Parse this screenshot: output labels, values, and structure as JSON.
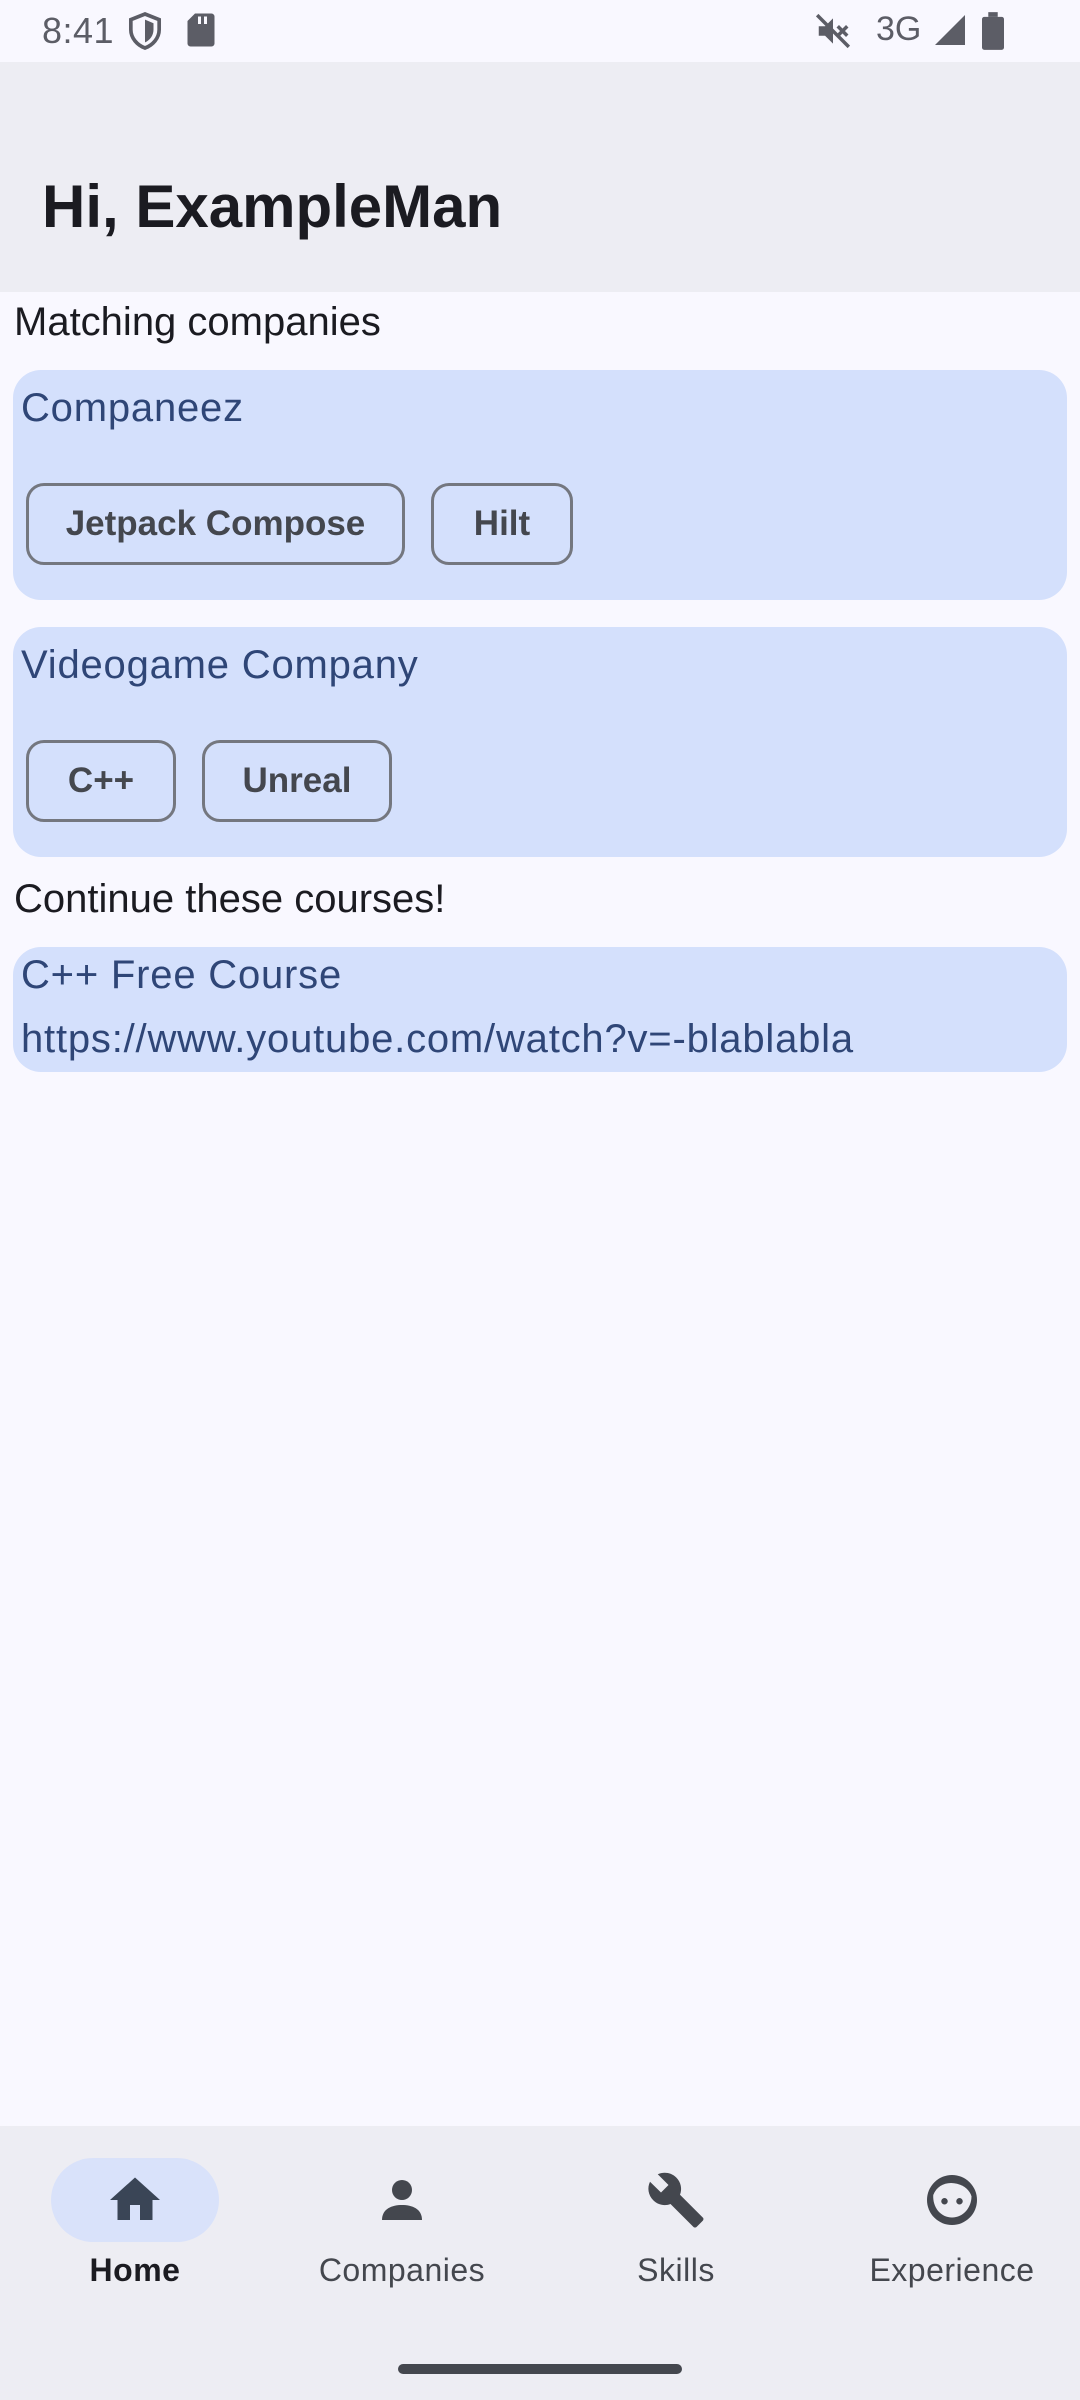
{
  "status_bar": {
    "time": "8:41",
    "network": "3G",
    "icons": [
      "shield-icon",
      "sd-card-icon",
      "mute-icon",
      "signal-icon",
      "battery-icon"
    ]
  },
  "header": {
    "greeting": "Hi, ExampleMan"
  },
  "matching": {
    "title": "Matching companies",
    "companies": [
      {
        "name": "Companeez",
        "skills": [
          "Jetpack Compose",
          "Hilt"
        ]
      },
      {
        "name": "Videogame Company",
        "skills": [
          "C++",
          "Unreal"
        ]
      }
    ]
  },
  "courses": {
    "title": "Continue these courses!",
    "items": [
      {
        "name": "C++ Free Course",
        "url": "https://www.youtube.com/watch?v=-blablabla"
      }
    ]
  },
  "bottom_nav": {
    "items": [
      {
        "label": "Home",
        "icon": "home-icon",
        "active": true
      },
      {
        "label": "Companies",
        "icon": "person-icon",
        "active": false
      },
      {
        "label": "Skills",
        "icon": "wrench-icon",
        "active": false
      },
      {
        "label": "Experience",
        "icon": "face-icon",
        "active": false
      }
    ]
  },
  "colors": {
    "background": "#f9f8ff",
    "top_bar": "#ededf3",
    "card": "#d4e0fc",
    "card_text": "#2f4677",
    "nav_active_pill": "#d9e2fa"
  }
}
